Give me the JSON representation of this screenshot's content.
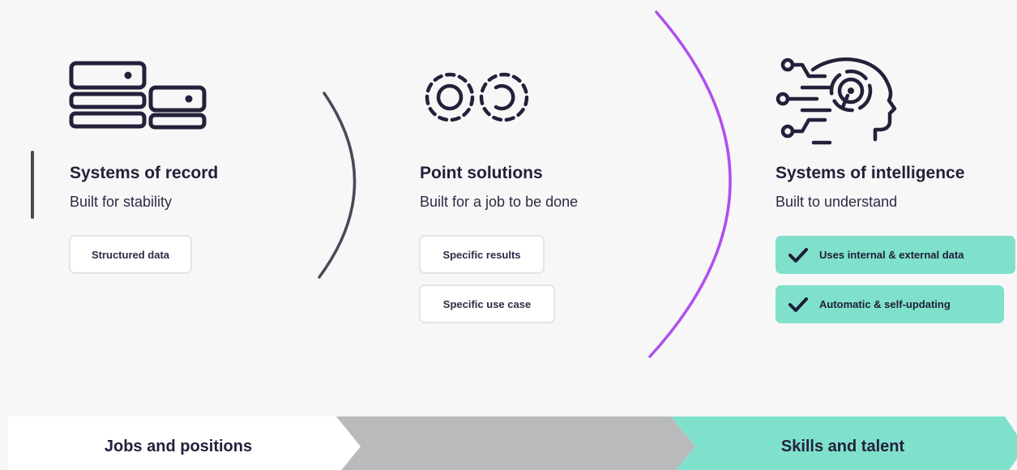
{
  "colors": {
    "background": "#f7f7f7",
    "ink": "#23213a",
    "curve_dark": "#474a57",
    "curve_purple": "#b04ef0",
    "accent_green": "#7fe0cc",
    "arrow_grey": "#b9babc",
    "arrow_white": "#ffffff"
  },
  "stages": [
    {
      "icon": "server-stack-icon",
      "title": "Systems of record",
      "subtitle": "Built for stability",
      "tags": [
        "Structured data"
      ]
    },
    {
      "icon": "gears-icon",
      "title": "Point solutions",
      "subtitle": "Built for a job to be done",
      "tags": [
        "Specific results",
        "Specific use case"
      ]
    },
    {
      "icon": "ai-head-icon",
      "title": "Systems of intelligence",
      "subtitle": "Built to understand",
      "tags": [
        "Uses internal & external data",
        "Automatic & self-updating"
      ],
      "tag_icon": "checkmark-icon"
    }
  ],
  "timeline": {
    "left_label": "Jobs and positions",
    "middle_label": "",
    "right_label": "Skills and talent"
  }
}
